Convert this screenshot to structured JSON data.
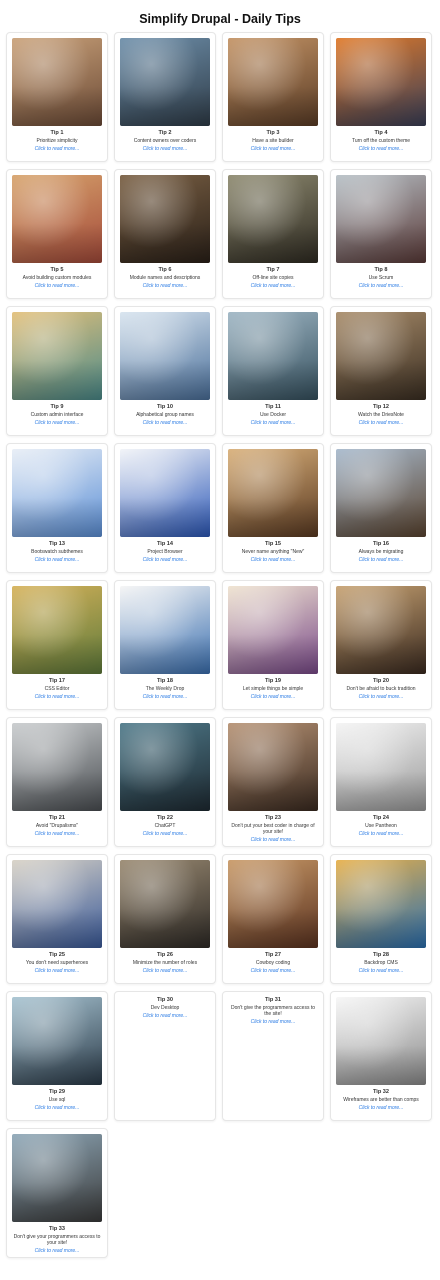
{
  "page": {
    "title": "Simplify Drupal - Daily Tips"
  },
  "link_text": "Click to read more...",
  "tips": [
    {
      "num": "Tip 1",
      "title": "Prioritize simplicity",
      "image": true,
      "colors": [
        "#caa27a",
        "#6b4a36"
      ]
    },
    {
      "num": "Tip 2",
      "title": "Content owners over coders",
      "image": true,
      "colors": [
        "#6e8faa",
        "#2f3c48"
      ]
    },
    {
      "num": "Tip 3",
      "title": "Have a site builder",
      "image": true,
      "colors": [
        "#c49466",
        "#5a3c26"
      ]
    },
    {
      "num": "Tip 4",
      "title": "Turn off the custom theme",
      "image": true,
      "colors": [
        "#e07a2a",
        "#3a3f58"
      ]
    },
    {
      "num": "Tip 5",
      "title": "Avoid building custom modules",
      "image": true,
      "colors": [
        "#d7a46d",
        "#a44a3a"
      ]
    },
    {
      "num": "Tip 6",
      "title": "Module names and descriptions",
      "image": true,
      "colors": [
        "#7a6044",
        "#2a2018"
      ]
    },
    {
      "num": "Tip 7",
      "title": "Off-line site copies",
      "image": true,
      "colors": [
        "#8e8a70",
        "#2f2b22"
      ]
    },
    {
      "num": "Tip 8",
      "title": "Use Scrum",
      "image": true,
      "colors": [
        "#b7c0c6",
        "#5a3a38"
      ]
    },
    {
      "num": "Tip 9",
      "title": "Custom admin interface",
      "image": true,
      "colors": [
        "#e3c07a",
        "#4a8a8a"
      ]
    },
    {
      "num": "Tip 10",
      "title": "Alphabetical group names",
      "image": true,
      "colors": [
        "#d8e4ef",
        "#4a6f9a"
      ]
    },
    {
      "num": "Tip 11",
      "title": "Use Docker",
      "image": true,
      "colors": [
        "#9fb6c4",
        "#35505e"
      ]
    },
    {
      "num": "Tip 12",
      "title": "Watch the DriesNote",
      "image": true,
      "colors": [
        "#a88c6a",
        "#3a2e22"
      ]
    },
    {
      "num": "Tip 13",
      "title": "Bootswatch subthemes",
      "image": true,
      "colors": [
        "#e8eef6",
        "#5b8fd6"
      ]
    },
    {
      "num": "Tip 14",
      "title": "Project Browser",
      "image": true,
      "colors": [
        "#f2f4f8",
        "#2c58b8"
      ]
    },
    {
      "num": "Tip 15",
      "title": "Never name anything \"New\"",
      "image": true,
      "colors": [
        "#d9b07a",
        "#5a3a22"
      ]
    },
    {
      "num": "Tip 16",
      "title": "Always be migrating",
      "image": true,
      "colors": [
        "#a7b9cc",
        "#5a4430"
      ]
    },
    {
      "num": "Tip 17",
      "title": "CSS Editor",
      "image": true,
      "colors": [
        "#d6b25a",
        "#5e7a3a"
      ]
    },
    {
      "num": "Tip 18",
      "title": "The Weekly Drop",
      "image": true,
      "colors": [
        "#f5f5f5",
        "#3a6fb0"
      ]
    },
    {
      "num": "Tip 19",
      "title": "Let simple things be simple",
      "image": true,
      "colors": [
        "#efe3d0",
        "#7a4a8a"
      ]
    },
    {
      "num": "Tip 20",
      "title": "Don't be afraid to buck tradition",
      "image": true,
      "colors": [
        "#c7a272",
        "#3a2a20"
      ]
    },
    {
      "num": "Tip 21",
      "title": "Avoid \"Drupalisms\"",
      "image": true,
      "colors": [
        "#c9ccce",
        "#4a4e52"
      ]
    },
    {
      "num": "Tip 22",
      "title": "ChatGPT",
      "image": true,
      "colors": [
        "#4f7a8a",
        "#1e2a32"
      ]
    },
    {
      "num": "Tip 23",
      "title": "Don't put your best coder in charge of your site!",
      "image": true,
      "colors": [
        "#b69274",
        "#3a2a20"
      ]
    },
    {
      "num": "Tip 24",
      "title": "Use Pantheon",
      "image": true,
      "colors": [
        "#f4f4f4",
        "#9a9a9a"
      ]
    },
    {
      "num": "Tip 25",
      "title": "You don't need superheroes",
      "image": true,
      "colors": [
        "#d8d2c6",
        "#3a5a9a"
      ]
    },
    {
      "num": "Tip 26",
      "title": "Minimize the number of roles",
      "image": true,
      "colors": [
        "#9a8a72",
        "#2e2a26"
      ]
    },
    {
      "num": "Tip 27",
      "title": "Cowboy coding",
      "image": true,
      "colors": [
        "#c99a68",
        "#5a3220"
      ]
    },
    {
      "num": "Tip 28",
      "title": "Backdrop CMS",
      "image": true,
      "colors": [
        "#e7b04a",
        "#2a6fb0"
      ]
    },
    {
      "num": "Tip 29",
      "title": "Use sql",
      "image": true,
      "colors": [
        "#a8c4d2",
        "#2a3a48"
      ]
    },
    {
      "num": "Tip 30",
      "title": "Dev Desktop",
      "image": false
    },
    {
      "num": "Tip 31",
      "title": "Don't give the programmers access to the site!",
      "image": false
    },
    {
      "num": "Tip 32",
      "title": "Wireframes are better than comps",
      "image": true,
      "colors": [
        "#f7f7f7",
        "#8a8a8a"
      ]
    },
    {
      "num": "Tip 33",
      "title": "Don't give your programmers access to your site!",
      "image": true,
      "colors": [
        "#8fa8b8",
        "#3a3a3a"
      ]
    }
  ]
}
